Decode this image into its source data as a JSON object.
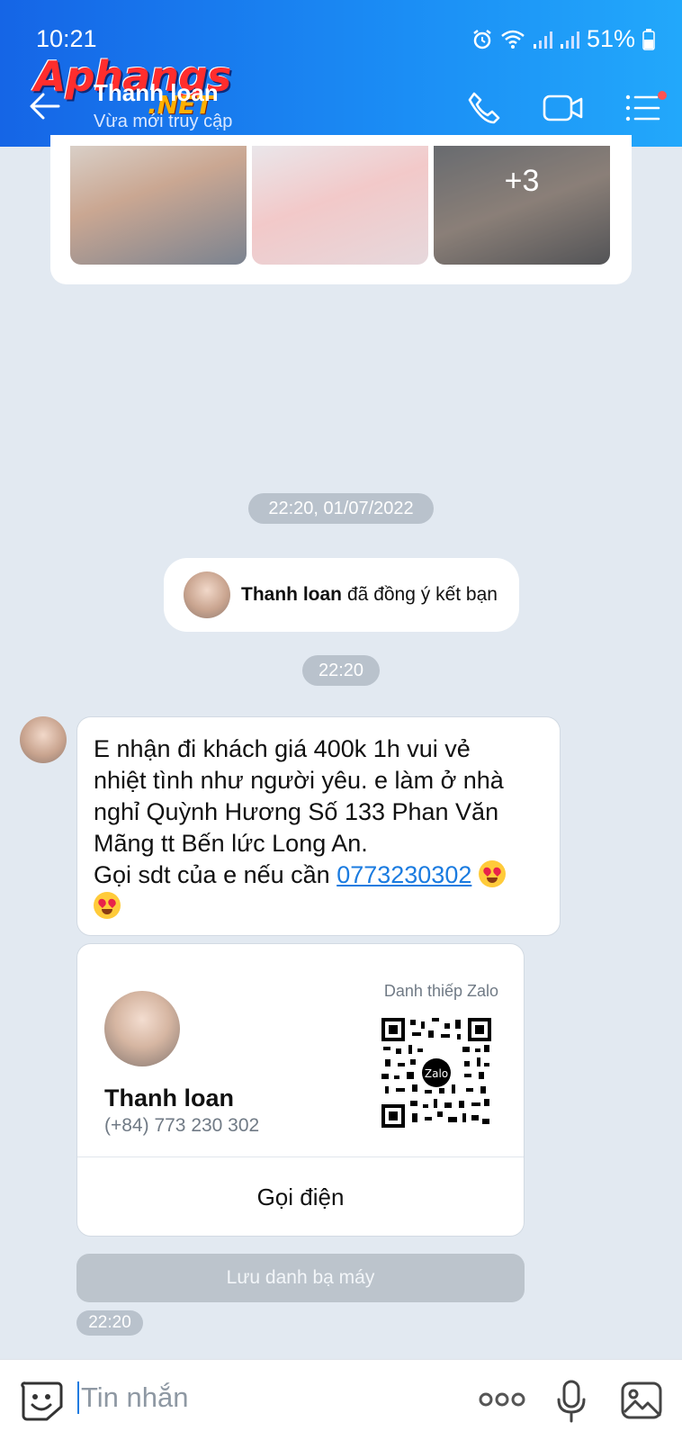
{
  "status_bar": {
    "time": "10:21",
    "battery": "51%"
  },
  "watermark": {
    "line1": "Aphangs",
    "line2": ".NET"
  },
  "header": {
    "contact_name": "Thanh loan",
    "contact_status": "Vừa mới truy cập",
    "icons": [
      "back-arrow-icon",
      "phone-icon",
      "video-call-icon",
      "menu-list-icon"
    ]
  },
  "image_gallery": {
    "more_count": "+3"
  },
  "messages": {
    "timestamp_1": "22:20, 01/07/2022",
    "system_name": "Thanh loan",
    "system_text": "đã đồng ý kết bạn",
    "timestamp_2": "22:20",
    "bubble_line1": "E   nhận đi khách giá 400k 1h vui vẻ",
    "bubble_line2": "nhiệt tình như người yêu. e làm ở nhà",
    "bubble_line3": "nghỉ Quỳnh Hương Số 133 Phan Văn",
    "bubble_line4": "Mãng tt Bến lức Long An.",
    "bubble_line5": "Gọi sdt của e nếu cần",
    "bubble_phone": "0773230302",
    "timestamp_3": "22:20"
  },
  "contact_card": {
    "label": "Danh thiếp Zalo",
    "name": "Thanh loan",
    "phone": "(+84) 773 230 302",
    "qr_center": "Zalo",
    "call_button": "Gọi điện",
    "save_button": "Lưu danh bạ máy"
  },
  "input_bar": {
    "placeholder": "Tin nhắn"
  },
  "colors": {
    "header_start": "#1565e6",
    "header_end": "#22a8fb",
    "link": "#1a7be0",
    "chat_bg": "#e2e9f1"
  }
}
